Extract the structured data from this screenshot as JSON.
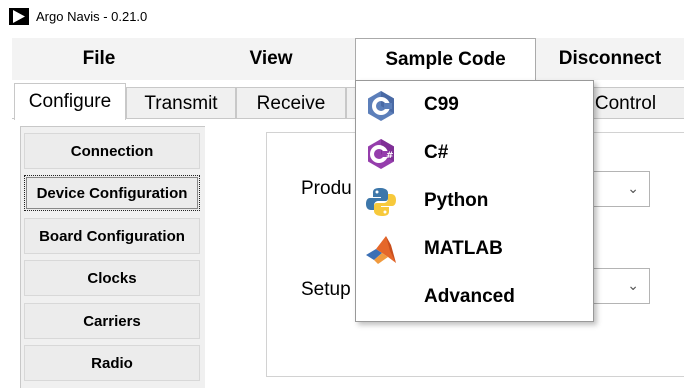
{
  "window": {
    "title": "Argo Navis - 0.21.0"
  },
  "menubar": {
    "file": "File",
    "view": "View",
    "sample_code": "Sample Code",
    "disconnect": "Disconnect"
  },
  "tabs": {
    "configure": "Configure",
    "transmit": "Transmit",
    "receive": "Receive",
    "control_partial": "n Control"
  },
  "sidebar": {
    "items": [
      {
        "label": "Connection"
      },
      {
        "label": "Device Configuration"
      },
      {
        "label": "Board Configuration"
      },
      {
        "label": "Clocks"
      },
      {
        "label": "Carriers"
      },
      {
        "label": "Radio"
      }
    ]
  },
  "main": {
    "product_label_partial": "Produ",
    "setup_label_partial": "Setup"
  },
  "sample_code_menu": {
    "items": [
      {
        "label": "C99",
        "icon": "c-language-icon"
      },
      {
        "label": "C#",
        "icon": "csharp-icon"
      },
      {
        "label": "Python",
        "icon": "python-icon"
      },
      {
        "label": "MATLAB",
        "icon": "matlab-icon"
      },
      {
        "label": "Advanced",
        "icon": ""
      }
    ]
  },
  "colors": {
    "menubar_bg": "#f3f3f3",
    "c_icon": "#5c7fba",
    "csharp_icon": "#953dac",
    "python_blue": "#3d77aa",
    "python_yellow": "#f7c93b",
    "matlab_orange": "#e5672a"
  }
}
